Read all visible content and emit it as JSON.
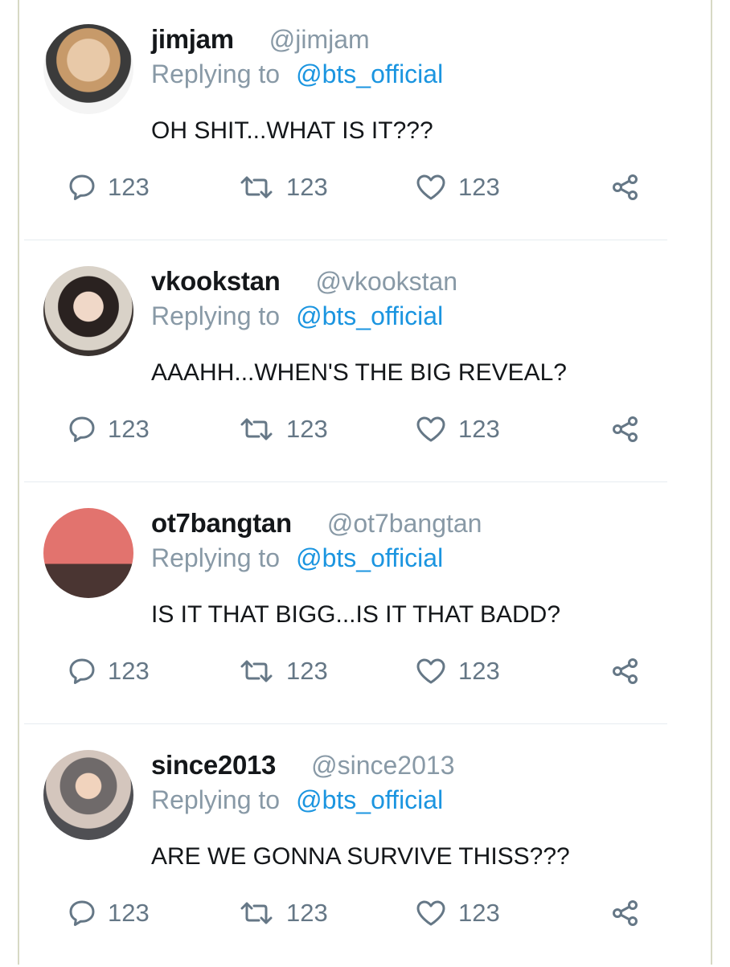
{
  "replies": [
    {
      "display_name": "jimjam",
      "handle": "@jimjam",
      "replying_label": "Replying to",
      "replying_to": "@bts_official",
      "text": "OH SHIT...WHAT IS IT???",
      "reply_count": "123",
      "retweet_count": "123",
      "like_count": "123"
    },
    {
      "display_name": "vkookstan",
      "handle": "@vkookstan",
      "replying_label": "Replying to",
      "replying_to": "@bts_official",
      "text": "AAAHH...WHEN'S THE BIG REVEAL?",
      "reply_count": "123",
      "retweet_count": "123",
      "like_count": "123"
    },
    {
      "display_name": "ot7bangtan",
      "handle": "@ot7bangtan",
      "replying_label": "Replying to",
      "replying_to": "@bts_official",
      "text": "IS IT THAT BIGG...IS IT THAT BADD?",
      "reply_count": "123",
      "retweet_count": "123",
      "like_count": "123"
    },
    {
      "display_name": "since2013",
      "handle": "@since2013",
      "replying_label": "Replying to",
      "replying_to": "@bts_official",
      "text": "ARE WE GONNA SURVIVE THISS???",
      "reply_count": "123",
      "retweet_count": "123",
      "like_count": "123"
    }
  ],
  "icons": {
    "reply": "reply-icon",
    "retweet": "retweet-icon",
    "like": "heart-icon",
    "share": "share-icon"
  },
  "colors": {
    "link": "#1b95e0",
    "muted": "#8899a6",
    "text": "#14171a",
    "action": "#657786"
  }
}
